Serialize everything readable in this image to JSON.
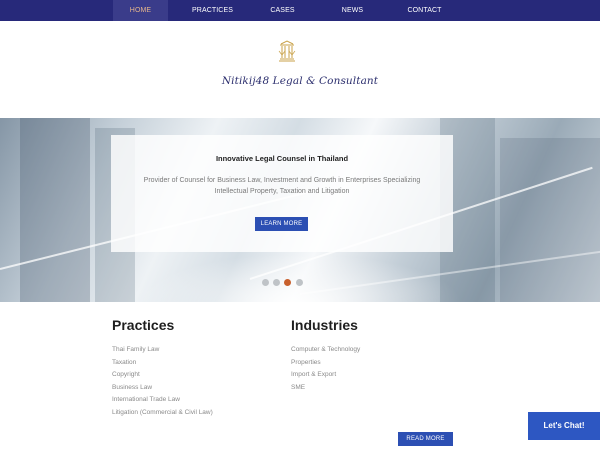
{
  "nav": {
    "items": [
      "HOME",
      "PRACTICES",
      "CASES",
      "NEWS",
      "CONTACT"
    ]
  },
  "brand": {
    "name": "Nitikij48 Legal & Consultant",
    "logo_icon": "pillar-scales-emblem",
    "accent_color": "#c9a24a"
  },
  "hero": {
    "title": "Innovative Legal Counsel in Thailand",
    "description": "Provider of Counsel for Business Law, Investment and Growth in Enterprises Specializing Intellectual Property, Taxation and Litigation",
    "button_label": "LEARN MORE",
    "slide_count": 4,
    "active_slide": 3
  },
  "practices": {
    "title": "Practices",
    "items": [
      "Thai Family Law",
      "Taxation",
      "Copyright",
      "Business Law",
      "International Trade Law",
      "Litigation (Commercial & Civil Law)"
    ]
  },
  "industries": {
    "title": "Industries",
    "items": [
      "Computer & Technology",
      "Properties",
      "Import & Export",
      "SME"
    ]
  },
  "read_more_label": "READ MORE",
  "chat_label": "Let's Chat!",
  "colors": {
    "nav_bg": "#27297a",
    "nav_active_text": "#e4b58c",
    "button_blue": "#2c4fb3",
    "active_dot": "#c8602d"
  }
}
